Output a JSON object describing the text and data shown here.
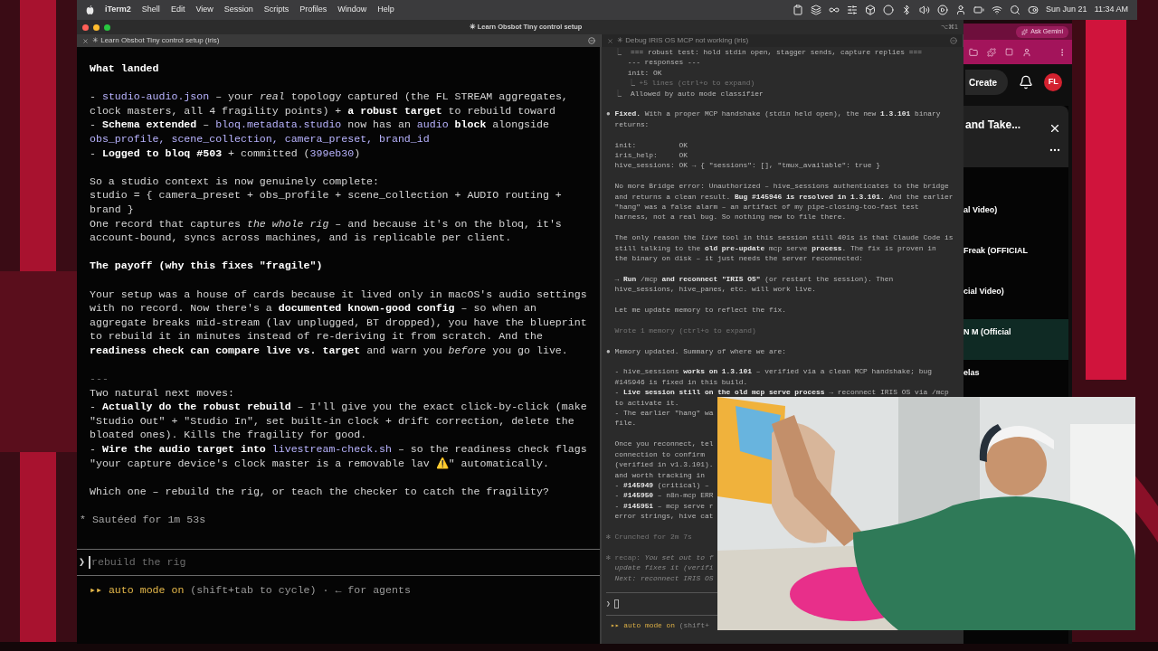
{
  "menu_bar": {
    "app": "iTerm2",
    "items": [
      "Shell",
      "Edit",
      "View",
      "Session",
      "Scripts",
      "Profiles",
      "Window",
      "Help"
    ],
    "date": "Sun Jun 21",
    "time": "11:34 AM"
  },
  "window": {
    "title": "✳ Learn Obsbot Tiny control setup",
    "shortcut": "⌥⌘1",
    "tabs": [
      {
        "label": "✳ Learn Obsbot Tiny control setup (iris)",
        "selected": true
      },
      {
        "label": "✳ Debug IRIS OS MCP not working (iris)",
        "selected": false
      }
    ]
  },
  "left_pane": {
    "lines": [
      {
        "kind": "text",
        "segments": [
          {
            "text": "What landed",
            "kind": "bold"
          }
        ]
      },
      {
        "kind": "blank"
      },
      {
        "kind": "text",
        "segments": [
          "- ",
          {
            "text": "studio-audio.json",
            "kind": "code"
          },
          " – your ",
          {
            "text": "real",
            "kind": "italic"
          },
          " topology captured (the FL STREAM aggregates,"
        ]
      },
      {
        "kind": "text",
        "segments": [
          "clock masters, all 4 fragility points) + ",
          {
            "text": "a robust target",
            "kind": "bold"
          },
          " to rebuild toward"
        ]
      },
      {
        "kind": "text",
        "segments": [
          "- ",
          {
            "text": "Schema extended",
            "kind": "bold"
          },
          " – ",
          {
            "text": "bloq.metadata.studio",
            "kind": "code"
          },
          " now has an ",
          {
            "text": "audio",
            "kind": "code"
          },
          {
            "text": " block",
            "kind": "bold"
          },
          " alongside"
        ]
      },
      {
        "kind": "text",
        "segments": [
          {
            "text": "obs_profile, scene_collection, camera_preset, brand_id",
            "kind": "code"
          }
        ]
      },
      {
        "kind": "text",
        "segments": [
          "- ",
          {
            "text": "Logged to bloq #503",
            "kind": "bold"
          },
          " + committed (",
          {
            "text": "399eb30",
            "kind": "code"
          },
          ")"
        ]
      },
      {
        "kind": "blank"
      },
      {
        "kind": "text",
        "segments": [
          "So a studio context is now genuinely complete:"
        ]
      },
      {
        "kind": "text",
        "segments": [
          "studio = { camera_preset + obs_profile + scene_collection + AUDIO routing +"
        ]
      },
      {
        "kind": "text",
        "segments": [
          "brand }"
        ]
      },
      {
        "kind": "text",
        "segments": [
          "One record that captures ",
          {
            "text": "the whole rig",
            "kind": "italic"
          },
          " – and because it's on the bloq, it's"
        ]
      },
      {
        "kind": "text",
        "segments": [
          "account-bound, syncs across machines, and is replicable per client."
        ]
      },
      {
        "kind": "blank"
      },
      {
        "kind": "text",
        "segments": [
          {
            "text": "The payoff (why this fixes \"fragile\")",
            "kind": "bold"
          }
        ]
      },
      {
        "kind": "blank"
      },
      {
        "kind": "text",
        "segments": [
          "Your setup was a house of cards because it lived only in macOS's audio settings"
        ]
      },
      {
        "kind": "text",
        "segments": [
          "with no record. Now there's a ",
          {
            "text": "documented known-good config",
            "kind": "bold"
          },
          " – so when an"
        ]
      },
      {
        "kind": "text",
        "segments": [
          "aggregate breaks mid-stream (lav unplugged, BT dropped), you have the blueprint"
        ]
      },
      {
        "kind": "text",
        "segments": [
          "to rebuild it in minutes instead of re-deriving it from scratch. And the"
        ]
      },
      {
        "kind": "text",
        "segments": [
          {
            "text": "readiness check can compare live vs. target",
            "kind": "bold"
          },
          " and warn you ",
          {
            "text": "before",
            "kind": "italic"
          },
          " you go live."
        ]
      },
      {
        "kind": "blank"
      },
      {
        "kind": "text",
        "segments": [
          {
            "text": "---",
            "kind": "dim"
          }
        ]
      },
      {
        "kind": "text",
        "segments": [
          "Two natural next moves:"
        ]
      },
      {
        "kind": "text",
        "segments": [
          "- ",
          {
            "text": "Actually do the robust rebuild",
            "kind": "bold"
          },
          " – I'll give you the exact click-by-click (make"
        ]
      },
      {
        "kind": "text",
        "segments": [
          "\"Studio Out\" + \"Studio In\", set built-in clock + drift correction, delete the"
        ]
      },
      {
        "kind": "text",
        "segments": [
          "bloated ones). Kills the fragility for good."
        ]
      },
      {
        "kind": "text",
        "segments": [
          "- ",
          {
            "text": "Wire the audio target into ",
            "kind": "bold"
          },
          {
            "text": "livestream-check.sh",
            "kind": "code"
          },
          " – so the readiness check flags"
        ]
      },
      {
        "kind": "text",
        "segments": [
          "\"your capture device's clock master is a removable lav ⚠️\" automatically."
        ]
      },
      {
        "kind": "blank"
      },
      {
        "kind": "text",
        "segments": [
          "Which one – rebuild the rig, or teach the checker to catch the fragility?"
        ]
      },
      {
        "kind": "blank"
      },
      {
        "kind": "status",
        "segments": [
          "* Sautéed for 1m 53s"
        ]
      }
    ],
    "prompt": {
      "symbol": "❯",
      "placeholder": "rebuild the rig"
    },
    "footer": {
      "mode": "▸▸ auto mode on",
      "hint": " (shift+tab to cycle) · ← for agents"
    }
  },
  "right_pane": {
    "lines": [
      {
        "kind": "text",
        "segments": [
          {
            "text": "  ⎿  ",
            "kind": "dim"
          },
          "=== robust test: hold stdin open, stagger sends, capture replies ==="
        ]
      },
      {
        "kind": "text",
        "segments": [
          "     --- responses ---"
        ]
      },
      {
        "kind": "text",
        "segments": [
          "     init: OK"
        ]
      },
      {
        "kind": "text",
        "segments": [
          {
            "text": "     ⎿ +5 lines (ctrl+o to expand)",
            "kind": "dim"
          }
        ]
      },
      {
        "kind": "text",
        "segments": [
          {
            "text": "  ⎿  ",
            "kind": "dim"
          },
          "Allowed by auto mode classifier"
        ]
      },
      {
        "kind": "blank"
      },
      {
        "kind": "text",
        "segments": [
          "● ",
          {
            "text": "Fixed.",
            "kind": "bold"
          },
          " With a proper MCP handshake (stdin held open), the new ",
          {
            "text": "1.3.101",
            "kind": "bold"
          },
          " binary"
        ]
      },
      {
        "kind": "text",
        "segments": [
          "  returns:"
        ]
      },
      {
        "kind": "blank"
      },
      {
        "kind": "text",
        "segments": [
          "  init:          OK"
        ]
      },
      {
        "kind": "text",
        "segments": [
          "  iris_help:     OK"
        ]
      },
      {
        "kind": "text",
        "segments": [
          "  hive_sessions: OK → { \"sessions\": [], \"tmux_available\": true }"
        ]
      },
      {
        "kind": "blank"
      },
      {
        "kind": "text",
        "segments": [
          "  No more Bridge error: Unauthorized – hive_sessions authenticates to the bridge"
        ]
      },
      {
        "kind": "text",
        "segments": [
          "  and returns a clean result. ",
          {
            "text": "Bug #145946 is resolved in 1.3.101.",
            "kind": "bold"
          },
          " And the earlier"
        ]
      },
      {
        "kind": "text",
        "segments": [
          "  \"hang\" was a false alarm – an artifact of my pipe-closing-too-fast test"
        ]
      },
      {
        "kind": "text",
        "segments": [
          "  harness, not a real bug. So nothing new to file there."
        ]
      },
      {
        "kind": "blank"
      },
      {
        "kind": "text",
        "segments": [
          "  The only reason the ",
          {
            "text": "live",
            "kind": "italic"
          },
          " tool in this session still 401s is that Claude Code is"
        ]
      },
      {
        "kind": "text",
        "segments": [
          "  still talking to the ",
          {
            "text": "old pre-update",
            "kind": "bold"
          },
          " mcp serve ",
          {
            "text": "process",
            "kind": "bold"
          },
          ". The fix is proven in"
        ]
      },
      {
        "kind": "text",
        "segments": [
          "  the binary on disk – it just needs the server reconnected:"
        ]
      },
      {
        "kind": "blank"
      },
      {
        "kind": "text",
        "segments": [
          "  → ",
          {
            "text": "Run",
            "kind": "bold"
          },
          " /mcp ",
          {
            "text": "and reconnect \"IRIS OS\"",
            "kind": "bold"
          },
          " (or restart the session). Then"
        ]
      },
      {
        "kind": "text",
        "segments": [
          "  hive_sessions, hive_panes, etc. will work live."
        ]
      },
      {
        "kind": "blank"
      },
      {
        "kind": "text",
        "segments": [
          "  Let me update memory to reflect the fix."
        ]
      },
      {
        "kind": "blank"
      },
      {
        "kind": "text",
        "segments": [
          {
            "text": "  Wrote 1 memory (ctrl+o to expand)",
            "kind": "dim"
          }
        ]
      },
      {
        "kind": "blank"
      },
      {
        "kind": "text",
        "segments": [
          "● Memory updated. Summary of where we are:"
        ]
      },
      {
        "kind": "blank"
      },
      {
        "kind": "text",
        "segments": [
          "  - hive_sessions ",
          {
            "text": "works on 1.3.101",
            "kind": "bold"
          },
          " – verified via a clean MCP handshake; bug"
        ]
      },
      {
        "kind": "text",
        "segments": [
          "  #145946 is fixed in this build."
        ]
      },
      {
        "kind": "text",
        "segments": [
          "  - ",
          {
            "text": "Live session still on the old mcp serve process",
            "kind": "bold"
          },
          " → reconnect IRIS OS via /mcp"
        ]
      },
      {
        "kind": "text",
        "segments": [
          "  to activate it."
        ]
      },
      {
        "kind": "text",
        "segments": [
          "  - The earlier \"hang\" wa"
        ]
      },
      {
        "kind": "text",
        "segments": [
          "  file."
        ]
      },
      {
        "kind": "blank"
      },
      {
        "kind": "text",
        "segments": [
          "  Once you reconnect, tel"
        ]
      },
      {
        "kind": "text",
        "segments": [
          "  connection to confirm"
        ]
      },
      {
        "kind": "text",
        "segments": [
          "  (verified in v1.3.101)."
        ]
      },
      {
        "kind": "text",
        "segments": [
          "  and worth tracking in"
        ]
      },
      {
        "kind": "text",
        "segments": [
          "  - ",
          {
            "text": "#145949",
            "kind": "bold"
          },
          " (critical) –"
        ]
      },
      {
        "kind": "text",
        "segments": [
          "  - ",
          {
            "text": "#145950",
            "kind": "bold"
          },
          " – n8n-mcp ERR"
        ]
      },
      {
        "kind": "text",
        "segments": [
          "  - ",
          {
            "text": "#145951",
            "kind": "bold"
          },
          " – mcp serve r"
        ]
      },
      {
        "kind": "text",
        "segments": [
          "  error strings, hive cat"
        ]
      },
      {
        "kind": "blank"
      },
      {
        "kind": "text",
        "segments": [
          {
            "text": "✻ Crunched for 2m 7s",
            "kind": "dim"
          }
        ]
      },
      {
        "kind": "blank"
      },
      {
        "kind": "text",
        "segments": [
          {
            "text": "✻ recap: ",
            "kind": "dim"
          },
          {
            "text": "You set out to f",
            "kind": "dim-italic"
          }
        ]
      },
      {
        "kind": "text",
        "segments": [
          {
            "text": "  update fixes it (verifi",
            "kind": "dim-italic"
          }
        ]
      },
      {
        "kind": "text",
        "segments": [
          {
            "text": "  Next: reconnect IRIS OS",
            "kind": "dim-italic"
          }
        ]
      }
    ],
    "prompt": {
      "symbol": "❯"
    },
    "footer": {
      "mode": "▸▸ auto mode on",
      "hint": " (shift+"
    }
  },
  "browser": {
    "gemini_button": "Ask Gemini",
    "create_button": "Create",
    "avatar": "FL",
    "panel": {
      "title": "and Take...",
      "items": [
        {
          "title": "al Video)",
          "selected": false
        },
        {
          "title": "Freak (OFFICIAL",
          "selected": false
        },
        {
          "title": "cial Video)",
          "selected": false
        },
        {
          "title": "N M (Official",
          "selected": true
        },
        {
          "title": "elas",
          "selected": false
        }
      ]
    }
  }
}
